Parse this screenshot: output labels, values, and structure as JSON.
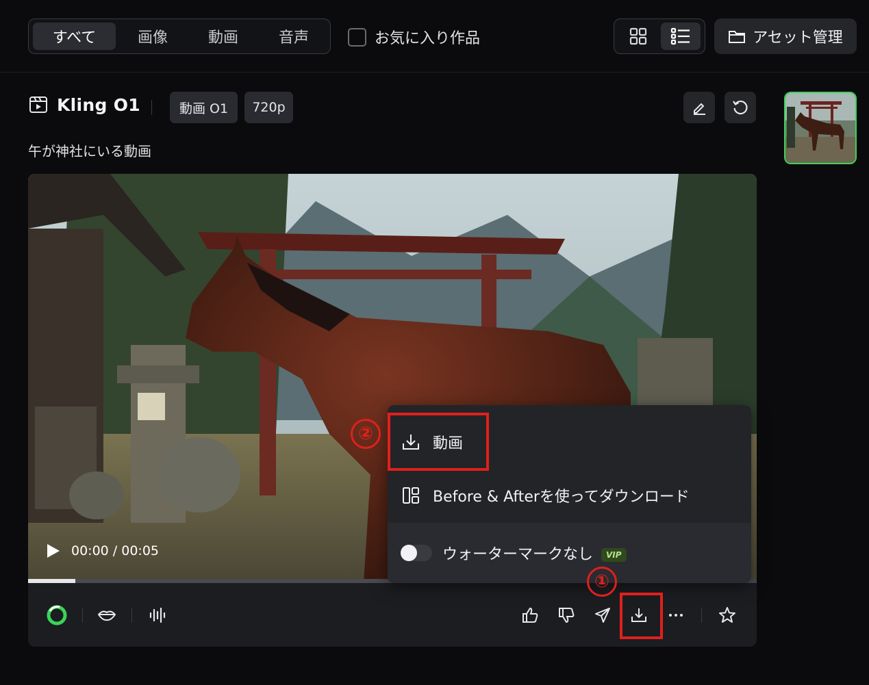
{
  "filter_tabs": [
    "すべて",
    "画像",
    "動画",
    "音声"
  ],
  "favorites_label": "お気に入り作品",
  "asset_button_label": "アセット管理",
  "model_title": "Kling O1",
  "chips": [
    "動画 O1",
    "720p"
  ],
  "prompt_text": "午が神社にいる動画",
  "player": {
    "time": "00:00 / 00:05",
    "progress_fraction": 0.065
  },
  "download_menu": {
    "items": [
      "動画",
      "Before & Afterを使ってダウンロード"
    ],
    "watermark_label": "ウォーターマークなし",
    "vip_badge": "VIP"
  },
  "step_markers": [
    "①",
    "②"
  ],
  "colors": {
    "accent_green": "#3bd35a",
    "annotation_red": "#e0201c"
  }
}
